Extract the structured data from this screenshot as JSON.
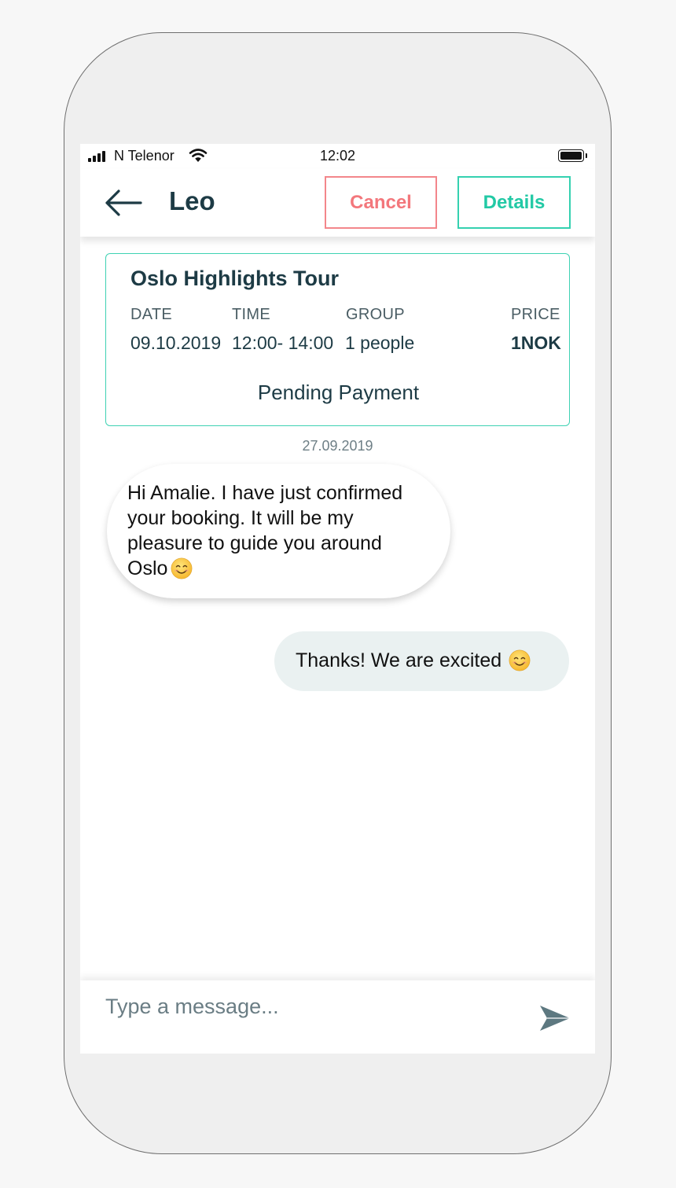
{
  "status_bar": {
    "carrier": "N Telenor",
    "time": "12:02",
    "icons": [
      "signal-icon",
      "wifi-icon",
      "battery-icon"
    ]
  },
  "header": {
    "back_icon": "arrow-left-icon",
    "title": "Leo",
    "cancel_label": "Cancel",
    "details_label": "Details"
  },
  "booking": {
    "tour_name": "Oslo Highlights Tour",
    "columns": [
      {
        "label": "DATE",
        "value": "09.10.2019"
      },
      {
        "label": "TIME",
        "value": "12:00- 14:00"
      },
      {
        "label": "GROUP",
        "value": "1 people"
      },
      {
        "label": "PRICE",
        "value": "1NOK"
      }
    ],
    "status": "Pending Payment"
  },
  "chat": {
    "date_separator": "27.09.2019",
    "messages": [
      {
        "direction": "incoming",
        "lines": [
          "Hi Amalie. I have just confirmed",
          "your booking. It will be my",
          "pleasure to guide you around",
          "Oslo"
        ],
        "emoji": "smiling-face-emoji"
      },
      {
        "direction": "outgoing",
        "text": "Thanks! We are excited",
        "emoji": "smiling-face-emoji"
      }
    ]
  },
  "composer": {
    "placeholder": "Type a message...",
    "value": "",
    "send_icon": "send-icon"
  },
  "colors": {
    "primary_text": "#1d3b45",
    "accent_teal": "#22c9a5",
    "cancel_red": "#f3777c",
    "outgoing_bubble": "#eaf1f1",
    "phone_frame": "#efefef"
  }
}
